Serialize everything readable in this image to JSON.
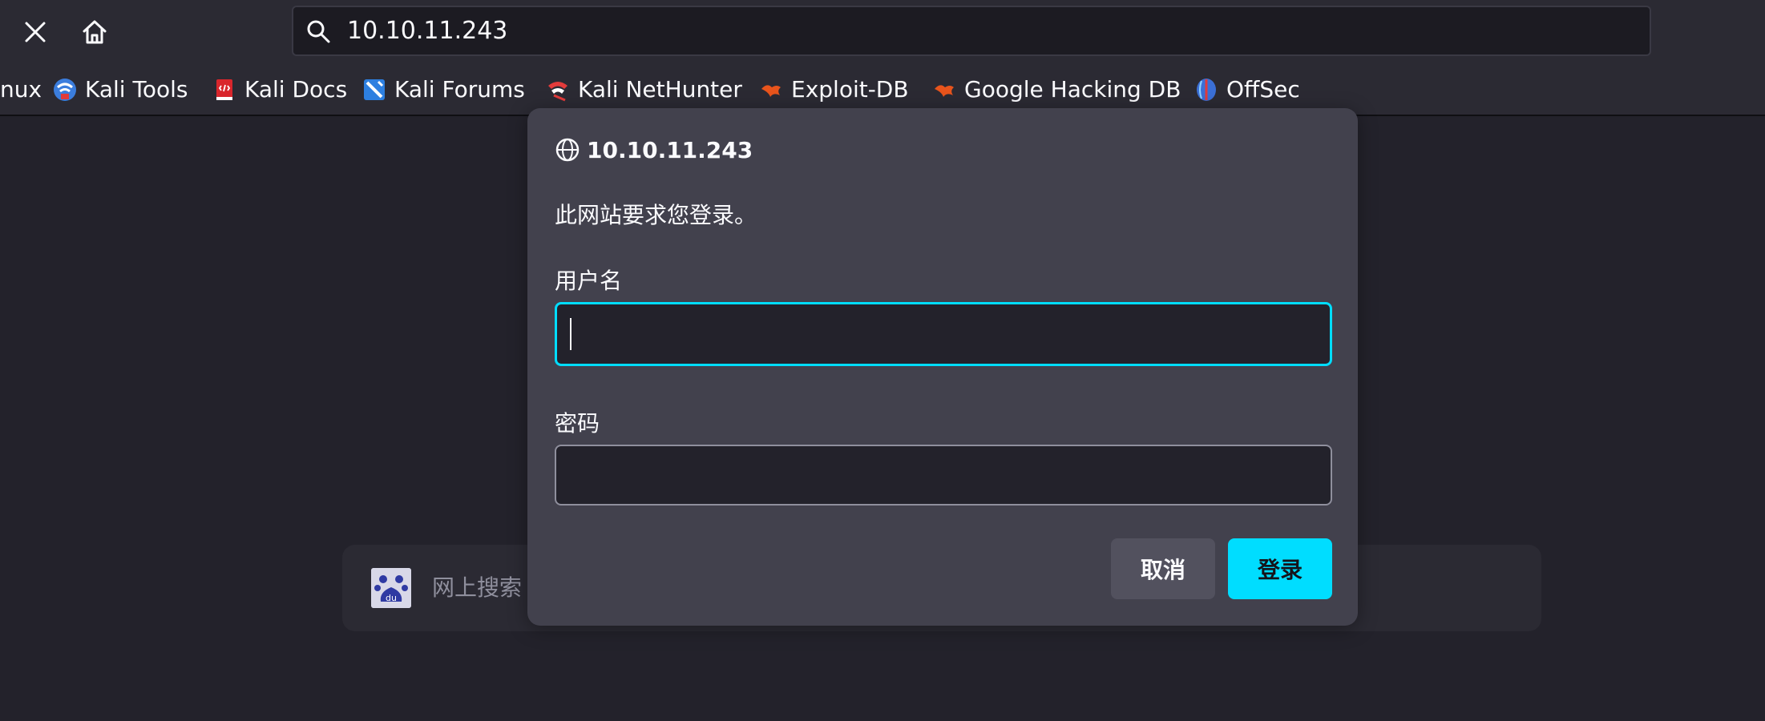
{
  "toolbar": {
    "url": "10.10.11.243",
    "icons": [
      "close-icon",
      "home-icon",
      "search-icon"
    ]
  },
  "bookmarks": [
    {
      "label": "nux",
      "icon": "none"
    },
    {
      "label": "Kali Tools",
      "icon": "kali-tools-favicon"
    },
    {
      "label": "Kali Docs",
      "icon": "kali-docs-favicon"
    },
    {
      "label": "Kali Forums",
      "icon": "kali-forums-favicon"
    },
    {
      "label": "Kali NetHunter",
      "icon": "kali-nethunter-favicon"
    },
    {
      "label": "Exploit-DB",
      "icon": "exploit-db-favicon"
    },
    {
      "label": "Google Hacking DB",
      "icon": "ghdb-favicon"
    },
    {
      "label": "OffSec",
      "icon": "offsec-favicon"
    }
  ],
  "background": {
    "search_placeholder": "网上搜索",
    "logo": "baidu-logo"
  },
  "dialog": {
    "host": "10.10.11.243",
    "message": "此网站要求您登录。",
    "username_label": "用户名",
    "username_value": "",
    "password_label": "密码",
    "password_value": "",
    "cancel_label": "取消",
    "login_label": "登录"
  },
  "colors": {
    "accent": "#00ddff",
    "toolbar_bg": "#2b2a33",
    "page_bg": "#23222b",
    "dialog_bg": "#42414d",
    "field_bg": "#23222b",
    "cancel_bg": "#52515e"
  }
}
